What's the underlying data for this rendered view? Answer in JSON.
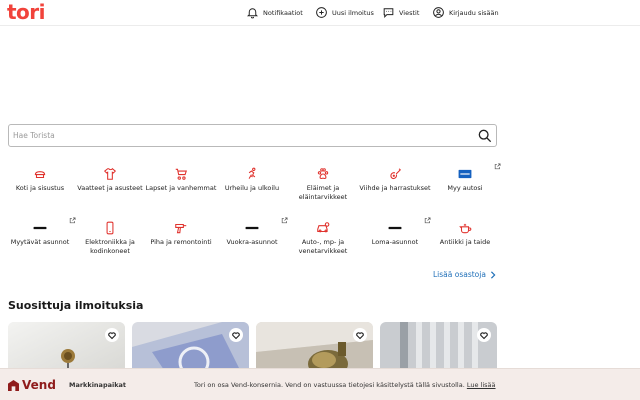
{
  "brand": {
    "logo_text": "tori",
    "logo_color": "#f1433b",
    "accent_link": "#1f6fb8"
  },
  "header": {
    "notifications": "Notifikaatiot",
    "new_listing": "Uusi ilmoitus",
    "messages": "Viestit",
    "login": "Kirjaudu sisään"
  },
  "search": {
    "placeholder": "Hae Torista",
    "value": ""
  },
  "categories": [
    {
      "label": "Koti ja sisustus",
      "icon": "lamp-icon"
    },
    {
      "label": "Vaatteet ja asusteet",
      "icon": "shirt-icon"
    },
    {
      "label": "Lapset ja vanhemmat",
      "icon": "stroller-icon"
    },
    {
      "label": "Urheilu ja ulkoilu",
      "icon": "runner-icon"
    },
    {
      "label": "Eläimet ja eläintarvikkeet",
      "icon": "paw-icon"
    },
    {
      "label": "Viihde ja harrastukset",
      "icon": "guitar-icon"
    },
    {
      "label": "Myy autosi",
      "icon": "partner-logo-icon",
      "external": true
    },
    {
      "label": "Myytävät asunnot",
      "icon": "partner-logo-icon",
      "external": true
    },
    {
      "label": "Elektroniikka ja kodinkoneet",
      "icon": "phone-icon"
    },
    {
      "label": "Piha ja remontointi",
      "icon": "drill-icon"
    },
    {
      "label": "Vuokra-asunnot",
      "icon": "partner-logo-icon",
      "external": true
    },
    {
      "label": "Auto-, mp- ja venetarvikkeet",
      "icon": "car-parts-icon"
    },
    {
      "label": "Loma-asunnot",
      "icon": "partner-logo-icon",
      "external": true
    },
    {
      "label": "Antiikki ja taide",
      "icon": "teapot-icon"
    }
  ],
  "more_categories": "Lisää osastoja",
  "featured": {
    "title": "Suosittuja ilmoituksia",
    "cards": [
      {
        "image": "ceiling-lamp-photo",
        "favorite_icon": "heart-icon"
      },
      {
        "image": "blue-book-photo",
        "favorite_icon": "heart-icon"
      },
      {
        "image": "brass-vase-photo",
        "favorite_icon": "heart-icon"
      },
      {
        "image": "radiator-photo",
        "favorite_icon": "heart-icon"
      }
    ]
  },
  "cookie_bar": {
    "brand": "Vend",
    "brand_sub": "Markkinapaikat",
    "text": "Tori on osa Vend-konsernia. Vend on vastuussa tietojesi käsittelystä tällä sivustolla.",
    "link": "Lue lisää"
  }
}
